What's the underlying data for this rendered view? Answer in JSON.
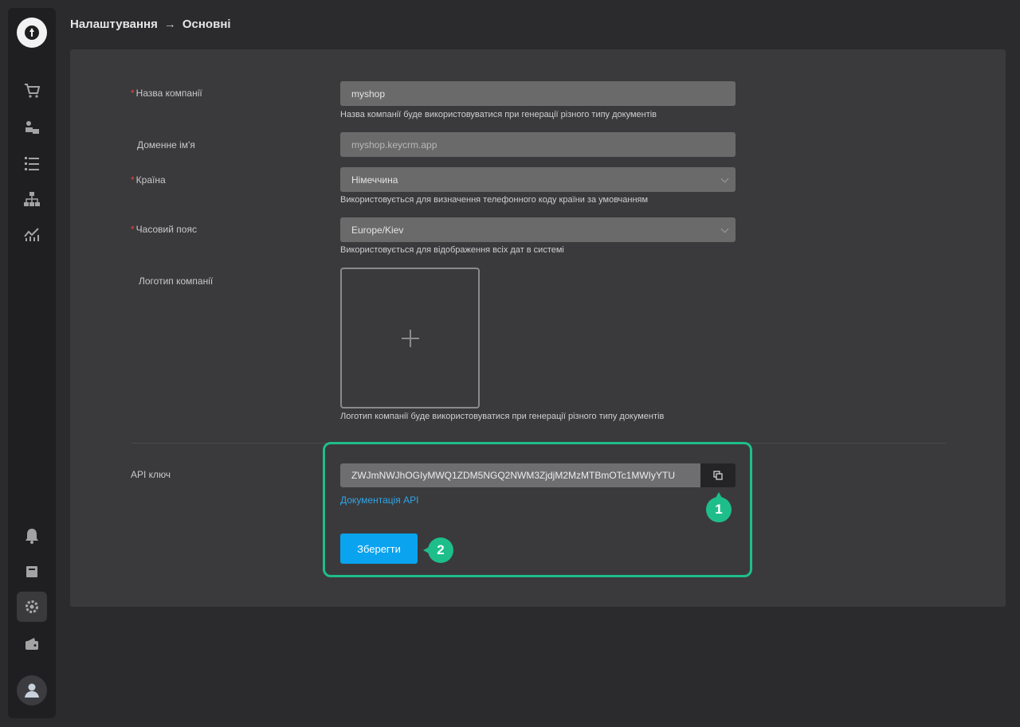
{
  "breadcrumb": {
    "parent": "Налаштування",
    "separator": "→",
    "current": "Основні"
  },
  "sidebar": {
    "items": [
      {
        "icon": "cart-icon"
      },
      {
        "icon": "tasks-icon"
      },
      {
        "icon": "list-icon"
      },
      {
        "icon": "hierarchy-icon"
      },
      {
        "icon": "analytics-icon"
      },
      {
        "icon": "bell-icon"
      },
      {
        "icon": "book-icon"
      },
      {
        "icon": "gear-icon",
        "active": true
      },
      {
        "icon": "wallet-icon"
      }
    ]
  },
  "form": {
    "company_name": {
      "label": "Назва компанії",
      "value": "myshop",
      "hint": "Назва компанії буде використовуватися при генерації різного типу документів"
    },
    "domain": {
      "label": "Доменне ім'я",
      "value": "myshop.keycrm.app"
    },
    "country": {
      "label": "Країна",
      "value": "Німеччина",
      "hint": "Використовується для визначення телефонного коду країни за умовчанням"
    },
    "timezone": {
      "label": "Часовий пояс",
      "value": "Europe/Kiev",
      "hint": "Використовується для відображення всіх дат в системі"
    },
    "logo": {
      "label": "Логотип компанії",
      "hint": "Логотип компанії буде використовуватися при генерації різного типу документів"
    },
    "api_key": {
      "label": "API ключ",
      "value": "ZWJmNWJhOGIyMWQ1ZDM5NGQ2NWM3ZjdjM2MzMTBmOTc1MWIyYTU",
      "doc_link": "Документація API"
    },
    "save_label": "Зберегти"
  },
  "markers": {
    "m1": "1",
    "m2": "2"
  },
  "colors": {
    "accent": "#0aa3ef",
    "highlight": "#1ebe8a",
    "link": "#2fa6e8",
    "required": "#e04a4a"
  }
}
